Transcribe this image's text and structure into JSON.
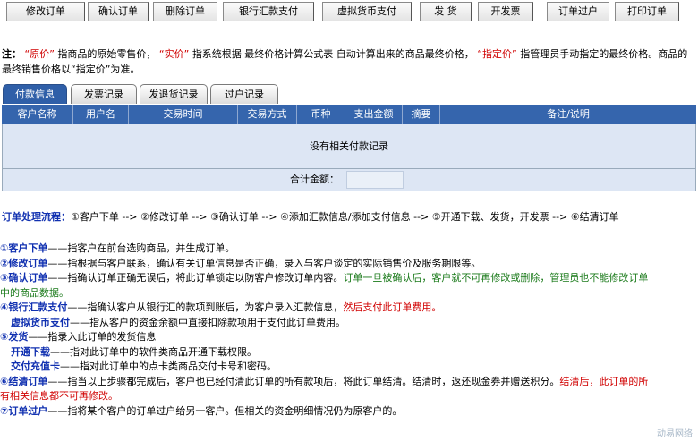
{
  "toolbar": {
    "buttons": [
      "修改订单",
      "确认订单",
      "删除订单",
      "银行汇款支付",
      "虚拟货币支付",
      "发 货",
      "开发票",
      "订单过户",
      "打印订单"
    ]
  },
  "note": {
    "prefix": "注：",
    "q1": "“原价”",
    "t1": "指商品的原始零售价，",
    "q2": "“实价”",
    "t2": "指系统根据 最终价格计算公式表 自动计算出来的商品最终价格，",
    "q3": "“指定价”",
    "t3": "指管理员手动指定的最终价格。商品的最终销售价格以“指定价”为准。"
  },
  "tabs": [
    "付款信息",
    "发票记录",
    "发退货记录",
    "过户记录"
  ],
  "table": {
    "headers": [
      "客户名称",
      "用户名",
      "交易时间",
      "交易方式",
      "币种",
      "支出金额",
      "摘要",
      "备注/说明"
    ],
    "empty_text": "没有相关付款记录",
    "total_label": "合计金额："
  },
  "flow": {
    "label": "订单处理流程：",
    "text": "①客户下单 --> ②修改订单 --> ③确认订单 --> ④添加汇款信息/添加支付信息 --> ⑤开通下载、发货，开发票 --> ⑥结清订单"
  },
  "desc": {
    "l1_title": "①客户下单",
    "l1_text": "——指客户在前台选购商品，并生成订单。",
    "l2_title": "②修改订单",
    "l2_text": "——指根据与客户联系，确认有关订单信息是否正确，录入与客户谈定的实际销售价及服务期限等。",
    "l3_title": "③确认订单",
    "l3_text": "——指确认订单正确无误后，将此订单锁定以防客户修改订单内容。",
    "l3_green": "订单一旦被确认后，客户就不可再修改或删除，管理员也不能修改订单",
    "l3b_green": "中的商品数据。",
    "l4_title": "④银行汇款支付",
    "l4_text": "——指确认客户从银行汇的款项到账后，为客户录入汇款信息，",
    "l4_red": "然后支付此订单费用。",
    "l5_title": "虚拟货币支付",
    "l5_text": "——指从客户的资金余额中直接扣除款项用于支付此订单费用。",
    "l6_title": "⑤发货",
    "l6_text": "——指录入此订单的发货信息",
    "l7_title": "开通下载",
    "l7_text": "——指对此订单中的软件类商品开通下载权限。",
    "l8_title": "交付充值卡",
    "l8_text": "——指对此订单中的点卡类商品交付卡号和密码。",
    "l9_title": "⑥结清订单",
    "l9_text": "——指当以上步骤都完成后，客户也已经付清此订单的所有款项后，将此订单结清。结清时，返还现金券并赠送积分。",
    "l9_red": "结清后，此订单的所",
    "l9b_red": "有相关信息都不可再修改。",
    "l10_title": "⑦订单过户",
    "l10_text": "——指将某个客户的订单过户给另一客户。但相关的资金明细情况仍为原客户的。"
  },
  "watermark": "动易网络"
}
